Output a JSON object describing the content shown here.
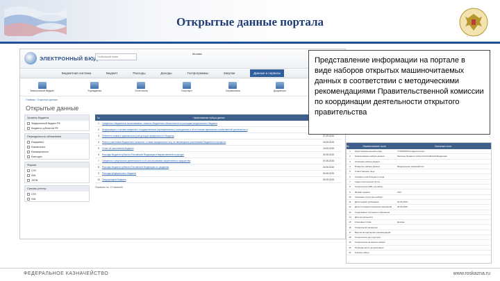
{
  "slide": {
    "title": "Открытые данные портала",
    "callout_text": "Представление информации на портале в виде наборов открытых машиночитаемых данных в соответствии с методическими рекомендациями Правительственной комиссии по координации деятельности открытого правительства",
    "footer_left": "ФЕДЕРАЛЬНОЕ КАЗНАЧЕЙСТВО",
    "footer_right": "www.roskazna.ru"
  },
  "portal": {
    "logo_text": "ЭЛЕКТРОННЫЙ БЮДЖЕТ",
    "search_placeholder": "Глобальный поиск",
    "login_text": "Москва",
    "nav": [
      {
        "label": "Бюджетная система"
      },
      {
        "label": "Бюджет"
      },
      {
        "label": "Расходы"
      },
      {
        "label": "Доходы"
      },
      {
        "label": "Госпрограммы"
      },
      {
        "label": "Закупки"
      },
      {
        "label": "Данные и сервисы",
        "active": true
      }
    ],
    "icons": [
      {
        "label": "Электронный бюджет"
      },
      {
        "label": "Учреждения"
      },
      {
        "label": "Отчетность"
      },
      {
        "label": "Госуслуги"
      },
      {
        "label": "Справочники"
      },
      {
        "label": "Документы"
      }
    ],
    "breadcrumb": "Главная › Открытые данные",
    "page_title": "Открытые данные",
    "sidebar": {
      "blocks": [
        {
          "head": "Уровень бюджета",
          "rows": [
            "Федеральный бюджет РФ",
            "Бюджеты субъектов РФ"
          ]
        },
        {
          "head": "Периодичность обновления",
          "rows": [
            "Ежедневно",
            "Ежемесячно",
            "Ежеквартально",
            "Ежегодно"
          ]
        },
        {
          "head": "Формат",
          "rows": [
            "CSV",
            "XML",
            "JSON"
          ]
        },
        {
          "head": "Скачать реестр",
          "rows": [
            "CSV",
            "XML"
          ]
        }
      ]
    },
    "table": {
      "headers": [
        "№",
        "Наименование набора данных",
        "Дата"
      ],
      "rows": [
        {
          "n": "1",
          "title": "Сведения о бюджетных ассигнованиях, лимитах бюджетных обязательств по расходам федерального бюджета",
          "date": "16.05.2015"
        },
        {
          "n": "2",
          "title": "Информация о составе сведений о государственных (муниципальных) учреждениях и об их планах финансово-хозяйственной деятельности",
          "date": "27.05.2015"
        },
        {
          "n": "3",
          "title": "Перечень главных администраторов доходов федерального бюджета",
          "date": "27.05.2015"
        },
        {
          "n": "4",
          "title": "Реестр участников бюджетного процесса, а также юридических лиц, не являющихся участниками бюджетного процесса",
          "date": "16.05.2015"
        },
        {
          "n": "5",
          "title": "Отчет об исполнении бюджета",
          "date": "16.05.2015"
        },
        {
          "n": "6",
          "title": "Расходы бюджета субъекта Российской Федерации в ведомственной структуре",
          "date": "04.06.2015"
        },
        {
          "n": "7",
          "title": "Сведения о результатах деятельности и об использовании закрепленного имущества",
          "date": "07.06.2015"
        },
        {
          "n": "8",
          "title": "Расходы бюджета субъекта Российской Федерации по разделам",
          "date": "04.06.2015"
        },
        {
          "n": "9",
          "title": "Расходы федерального бюджета",
          "date": "04.06.2015"
        },
        {
          "n": "10",
          "title": "Свод доходов бюджета",
          "date": "04.06.2015"
        }
      ],
      "pager": "Показать по: 10 записей"
    },
    "detail_table": {
      "headers": [
        "№",
        "Наименование поля",
        "Значение поля"
      ],
      "rows": [
        {
          "n": "1",
          "k": "Идентификационный номер",
          "v": "7710568760-budgetexecution"
        },
        {
          "n": "2",
          "k": "Наименование набора данных",
          "v": "Расходы бюджета субъекта Российской Федерации"
        },
        {
          "n": "3",
          "k": "Описание набора данных",
          "v": ""
        },
        {
          "n": "4",
          "k": "Владелец набора данных",
          "v": "Федеральное казначейство"
        },
        {
          "n": "5",
          "k": "Ответственное лицо",
          "v": ""
        },
        {
          "n": "6",
          "k": "Телефон ответственного лица",
          "v": ""
        },
        {
          "n": "7",
          "k": "Адрес электронной почты",
          "v": ""
        },
        {
          "n": "8",
          "k": "Гиперссылка (URL) на набор",
          "v": ""
        },
        {
          "n": "9",
          "k": "Формат данных",
          "v": "CSV"
        },
        {
          "n": "10",
          "k": "Описание структуры набора",
          "v": ""
        },
        {
          "n": "11",
          "k": "Дата первой публикации",
          "v": "04.06.2015"
        },
        {
          "n": "12",
          "k": "Дата последнего внесения изменений",
          "v": "04.06.2015"
        },
        {
          "n": "13",
          "k": "Содержание последнего изменения",
          "v": ""
        },
        {
          "n": "14",
          "k": "Дата актуальности",
          "v": ""
        },
        {
          "n": "15",
          "k": "Ключевые слова",
          "v": "Доходы"
        },
        {
          "n": "16",
          "k": "Гиперссылки на версии",
          "v": ""
        },
        {
          "n": "17",
          "k": "Версия методических рекомендаций",
          "v": ""
        },
        {
          "n": "18",
          "k": "Гиперссылки на структуры",
          "v": ""
        },
        {
          "n": "19",
          "k": "Гиперссылка на версии набора",
          "v": ""
        },
        {
          "n": "20",
          "k": "Периодичность актуализации",
          "v": ""
        },
        {
          "n": "21",
          "k": "Скачать набор",
          "v": ""
        }
      ]
    }
  }
}
